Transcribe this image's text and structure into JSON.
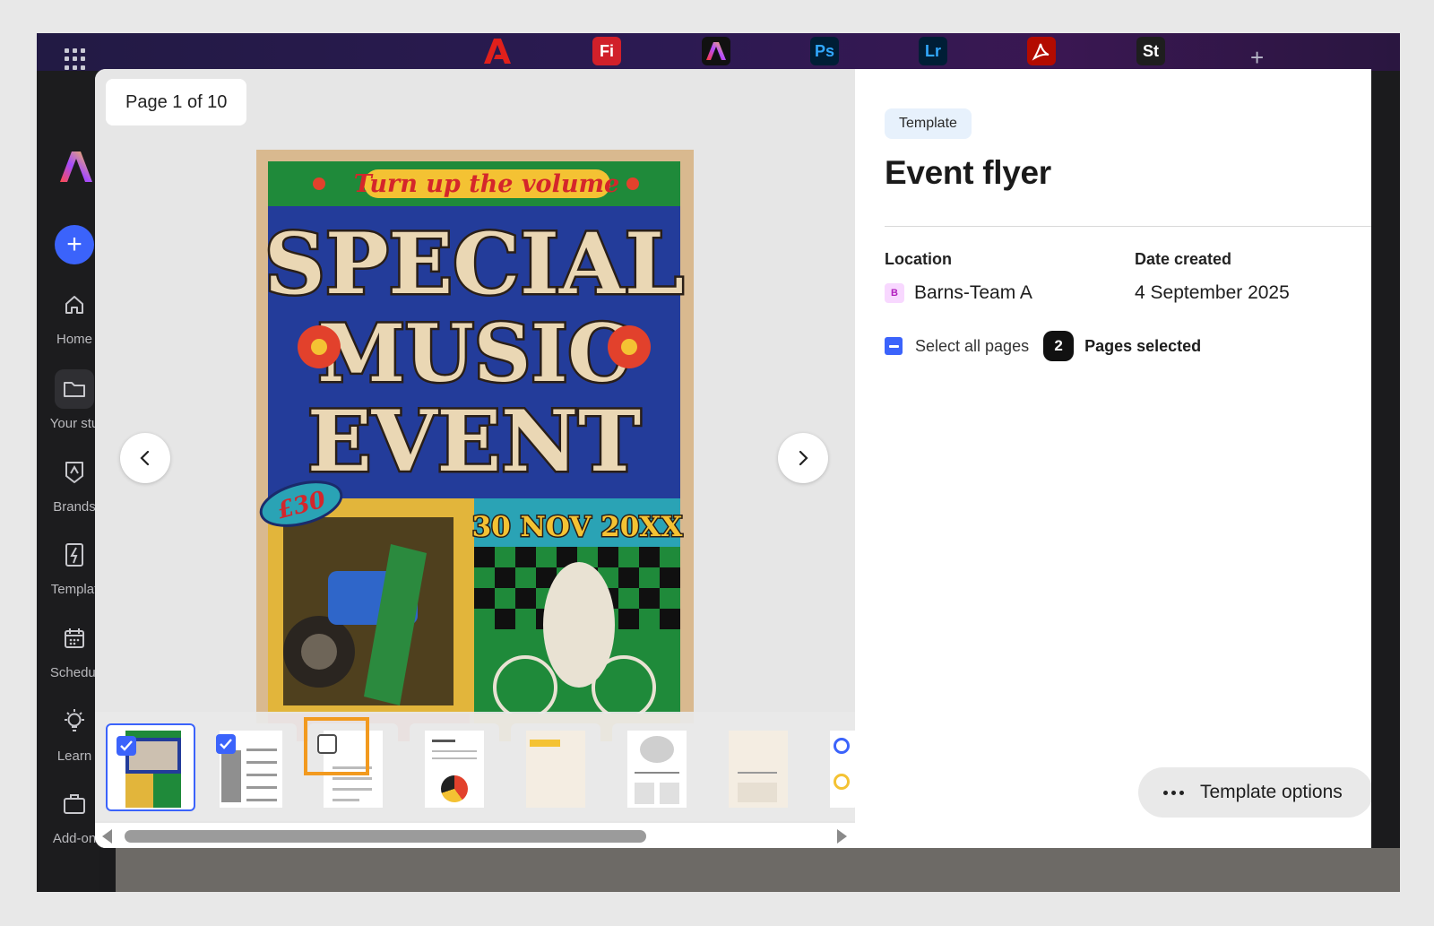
{
  "topbar": {
    "apps": [
      {
        "name": "Adobe",
        "abbr": "A",
        "color": "#e0201b",
        "bg": "transparent"
      },
      {
        "name": "Fresco",
        "abbr": "Fi",
        "color": "#ffffff",
        "bg": "#d1202a"
      },
      {
        "name": "Express",
        "abbr": "A",
        "color": "#ffffff",
        "bg": "#111111"
      },
      {
        "name": "Photoshop",
        "abbr": "Ps",
        "color": "#31a8ff",
        "bg": "#001e36"
      },
      {
        "name": "Lightroom",
        "abbr": "Lr",
        "color": "#31a8ff",
        "bg": "#001e36"
      },
      {
        "name": "Acrobat",
        "abbr": "A",
        "color": "#ffffff",
        "bg": "#b30b00"
      },
      {
        "name": "Stock",
        "abbr": "St",
        "color": "#ffffff",
        "bg": "#1e1e1e"
      }
    ],
    "new_tab": "+"
  },
  "sidebar": {
    "create_label": "+",
    "items": [
      {
        "label": "Home",
        "icon": "home-icon"
      },
      {
        "label": "Your stu",
        "icon": "folder-icon"
      },
      {
        "label": "Brands",
        "icon": "brand-icon"
      },
      {
        "label": "Templat",
        "icon": "template-icon"
      },
      {
        "label": "Schedul",
        "icon": "calendar-icon"
      },
      {
        "label": "Learn",
        "icon": "lightbulb-icon"
      },
      {
        "label": "Add-on",
        "icon": "briefcase-icon"
      }
    ]
  },
  "preview": {
    "page_indicator": "Page 1 of 10",
    "flyer": {
      "tagline": "Turn up the volume",
      "headline": [
        "SPECIAL",
        "MUSIC",
        "EVENT"
      ],
      "price": "£30",
      "date": "30 NOV 20XX"
    },
    "thumbnails": [
      {
        "index": 1,
        "checked": true
      },
      {
        "index": 2,
        "checked": true
      },
      {
        "index": 3,
        "checked": false
      },
      {
        "index": 4,
        "checked": null
      },
      {
        "index": 5,
        "checked": null
      },
      {
        "index": 6,
        "checked": null
      },
      {
        "index": 7,
        "checked": null
      },
      {
        "index": 8,
        "checked": null
      }
    ]
  },
  "details": {
    "badge": "Template",
    "title": "Event flyer",
    "location_label": "Location",
    "location_badge": "B",
    "location_value": "Barns-Team A",
    "date_label": "Date created",
    "date_value": "4 September 2025",
    "select_all_label": "Select all pages",
    "selected_count": "2",
    "selected_label": "Pages selected",
    "options_label": "Template options"
  },
  "colors": {
    "accent": "#3b63fb",
    "highlight": "#f29a1f"
  }
}
